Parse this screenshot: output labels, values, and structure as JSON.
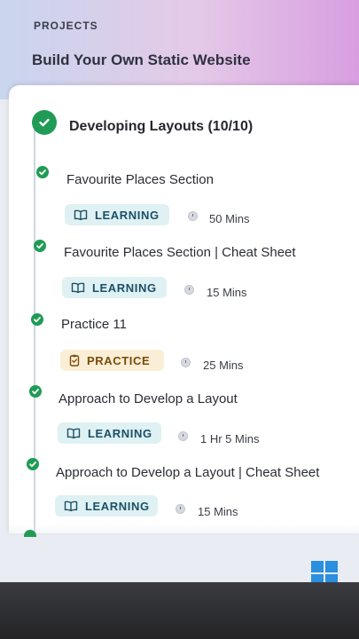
{
  "header": {
    "label": "PROJECTS",
    "title": "Build Your Own Static Website"
  },
  "section": {
    "title": "Developing Layouts (10/10)"
  },
  "items": [
    {
      "title": "Favourite Places Section",
      "badge": "LEARNING",
      "type": "learning",
      "duration": "50 Mins"
    },
    {
      "title": "Favourite Places Section | Cheat Sheet",
      "badge": "LEARNING",
      "type": "learning",
      "duration": "15 Mins"
    },
    {
      "title": "Practice 11",
      "badge": "PRACTICE",
      "type": "practice",
      "duration": "25 Mins"
    },
    {
      "title": "Approach to Develop a Layout",
      "badge": "LEARNING",
      "type": "learning",
      "duration": "1 Hr 5 Mins"
    },
    {
      "title": "Approach to Develop a Layout | Cheat Sheet",
      "badge": "LEARNING",
      "type": "learning",
      "duration": "15 Mins"
    }
  ],
  "colors": {
    "complete": "#1f9b55",
    "learning_bg": "#dff1f2",
    "practice_bg": "#fbeed6"
  },
  "icons": {
    "check": "check-icon",
    "learning": "book-icon",
    "practice": "clipboard-icon",
    "duration": "clock-icon",
    "os": "windows-logo-icon"
  }
}
